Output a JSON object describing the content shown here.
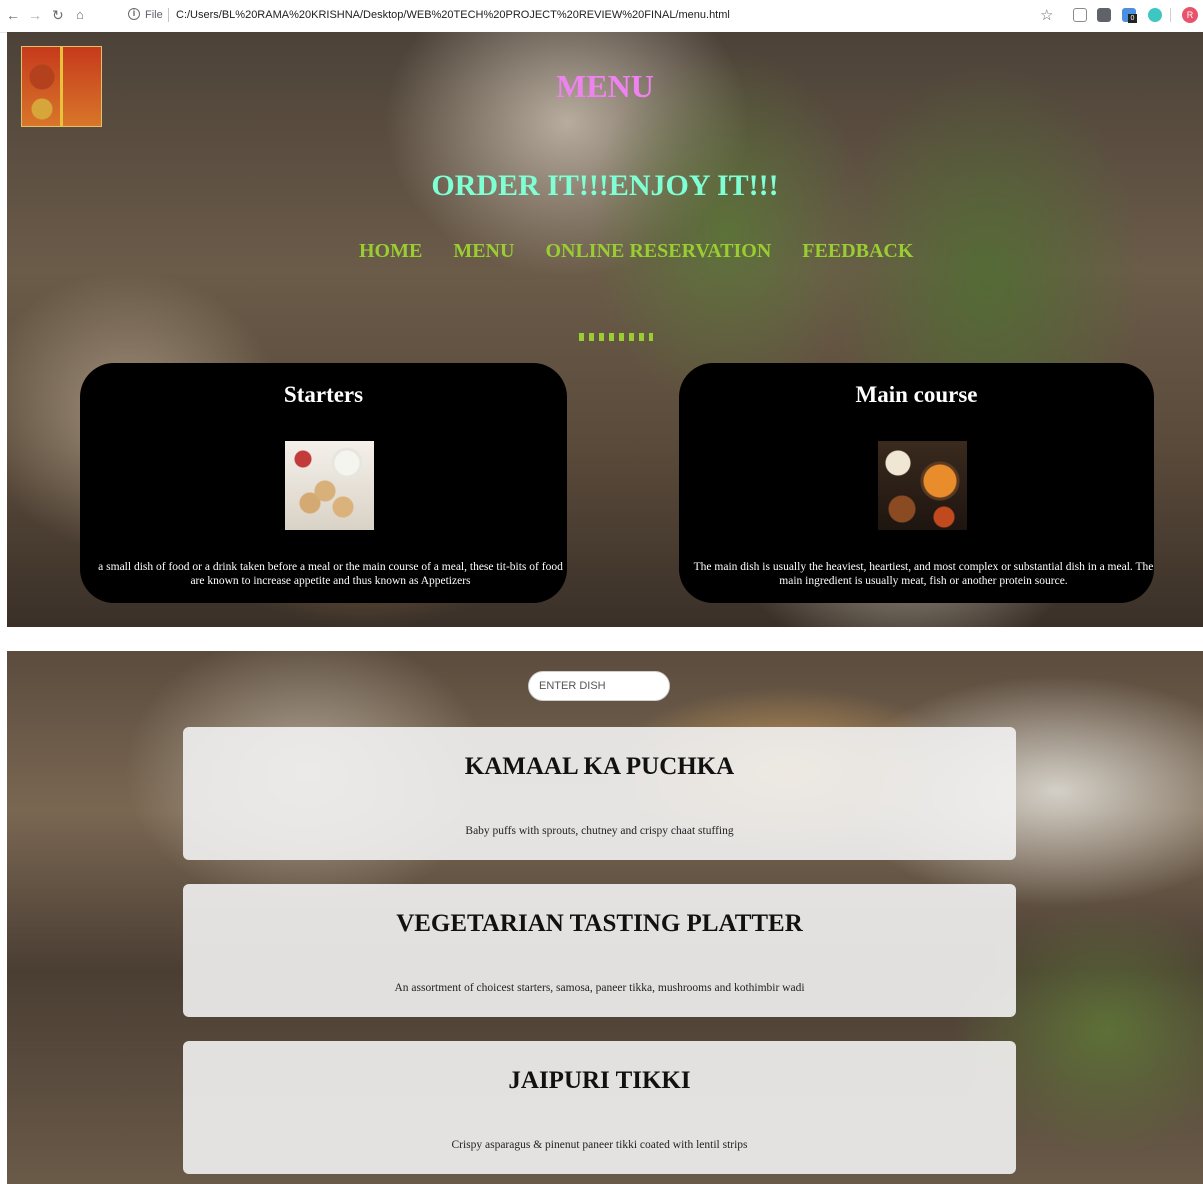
{
  "browser": {
    "scheme": "File",
    "url": "C:/Users/BL%20RAMA%20KRISHNA/Desktop/WEB%20TECH%20PROJECT%20REVIEW%20FINAL/menu.html",
    "extension_badge": "0",
    "profile_initial": "R"
  },
  "header": {
    "title": "MENU",
    "tagline": "ORDER IT!!!ENJOY IT!!!"
  },
  "nav": {
    "home": "HOME",
    "menu": "MENU",
    "reservation": "ONLINE RESERVATION",
    "feedback": "FEEDBACK"
  },
  "categories": [
    {
      "title": "Starters",
      "description": "a small dish of food or a drink taken before a meal or the main course of a meal, these tit-bits of food are known to increase appetite and thus known as Appetizers"
    },
    {
      "title": "Main course",
      "description": "The main dish is usually the heaviest, heartiest, and most complex or substantial dish in a meal. The main ingredient is usually meat, fish or another protein source."
    }
  ],
  "search": {
    "placeholder": "ENTER DISH"
  },
  "dishes": [
    {
      "name": "KAMAAL KA PUCHKA",
      "description": "Baby puffs with sprouts, chutney and crispy chaat stuffing"
    },
    {
      "name": "VEGETARIAN TASTING PLATTER",
      "description": "An assortment of choicest starters, samosa, paneer tikka, mushrooms and kothimbir wadi"
    },
    {
      "name": "JAIPURI TIKKI",
      "description": "Crispy asparagus & pinenut paneer tikki coated with lentil strips"
    }
  ],
  "colors": {
    "title": "#ee82ee",
    "tagline": "#7fffd4",
    "nav": "#9acd32",
    "card_bg": "#000000"
  }
}
